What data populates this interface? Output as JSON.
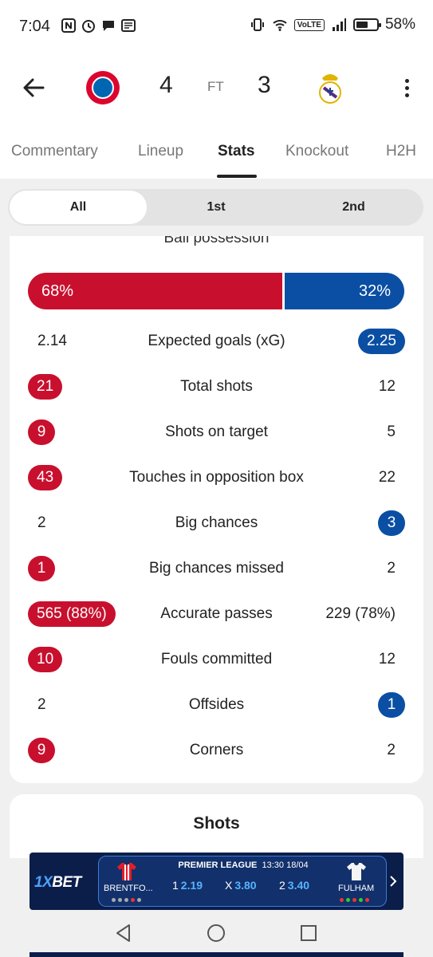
{
  "status_bar": {
    "time": "7:04",
    "network": "VoLTE",
    "battery": "58%",
    "battery_level": 0.58
  },
  "match": {
    "home_score": "4",
    "status": "FT",
    "away_score": "3",
    "home_crest_icon": "bayern-munich-crest-icon",
    "away_crest_icon": "real-madrid-crest-icon"
  },
  "tabs": [
    {
      "label": "Commentary",
      "active": false
    },
    {
      "label": "Lineup",
      "active": false
    },
    {
      "label": "Stats",
      "active": true
    },
    {
      "label": "Knockout",
      "active": false
    },
    {
      "label": "H2H",
      "active": false
    }
  ],
  "periods": [
    {
      "label": "All",
      "active": true
    },
    {
      "label": "1st",
      "active": false
    },
    {
      "label": "2nd",
      "active": false
    }
  ],
  "possession": {
    "title": "Ball possession",
    "home": "68%",
    "away": "32%",
    "home_share": 0.68
  },
  "stats": [
    {
      "label": "Expected goals (xG)",
      "home": "2.14",
      "away": "2.25",
      "highlight": "away"
    },
    {
      "label": "Total shots",
      "home": "21",
      "away": "12",
      "highlight": "home"
    },
    {
      "label": "Shots on target",
      "home": "9",
      "away": "5",
      "highlight": "home"
    },
    {
      "label": "Touches in opposition box",
      "home": "43",
      "away": "22",
      "highlight": "home"
    },
    {
      "label": "Big chances",
      "home": "2",
      "away": "3",
      "highlight": "away"
    },
    {
      "label": "Big chances missed",
      "home": "1",
      "away": "2",
      "highlight": "home"
    },
    {
      "label": "Accurate passes",
      "home": "565 (88%)",
      "away": "229 (78%)",
      "highlight": "home"
    },
    {
      "label": "Fouls committed",
      "home": "10",
      "away": "12",
      "highlight": "home"
    },
    {
      "label": "Offsides",
      "home": "2",
      "away": "1",
      "highlight": "away"
    },
    {
      "label": "Corners",
      "home": "9",
      "away": "2",
      "highlight": "home"
    }
  ],
  "shots_section": {
    "title": "Shots"
  },
  "ad": {
    "brand_x": "1X",
    "brand_rest": "BET",
    "league": "PREMIER LEAGUE",
    "kickoff": "13:30 18/04",
    "home_team": "BRENTFO...",
    "away_team": "FULHAM",
    "odds": [
      {
        "key": "1",
        "value": "2.19"
      },
      {
        "key": "X",
        "value": "3.80"
      },
      {
        "key": "2",
        "value": "3.40"
      }
    ]
  },
  "colors": {
    "home": "#c8102e",
    "away": "#0a4fa3"
  }
}
